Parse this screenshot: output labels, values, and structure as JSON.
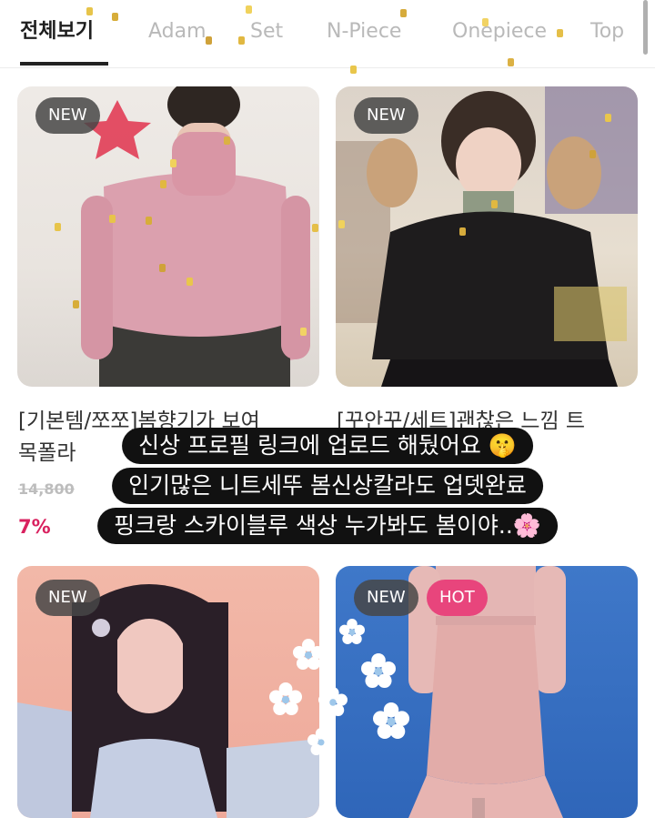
{
  "tabs": [
    {
      "label": "전체보기"
    },
    {
      "label": "Adam"
    },
    {
      "label": "Set"
    },
    {
      "label": "N-Piece"
    },
    {
      "label": "Onepiece"
    },
    {
      "label": "Top"
    }
  ],
  "products": [
    {
      "badge": "NEW",
      "title": "[기본템/쪼쪼]봄향기가 보여",
      "subtitle": "목폴라",
      "old_price": "14,800",
      "discount": "7%"
    },
    {
      "badge": "NEW",
      "title": "[꾸안꾸/세트]괜찮은 느낌 트"
    },
    {
      "badge": "NEW"
    },
    {
      "badge": "NEW",
      "badge2": "HOT"
    }
  ],
  "caption": {
    "line1": "신상 프로필 링크에 업로드 해뒀어요 🤫",
    "line2": "인기많은 니트세뚜 봄신상칼라도 업뎃완료",
    "line3": "핑크랑 스카이블루 색상 누가봐도 봄이야..🌸"
  },
  "colors": {
    "accent": "#d9215f",
    "hot": "#e8457c",
    "tab_active": "#1f1f1f",
    "tab_inactive": "#b9b9b9"
  }
}
